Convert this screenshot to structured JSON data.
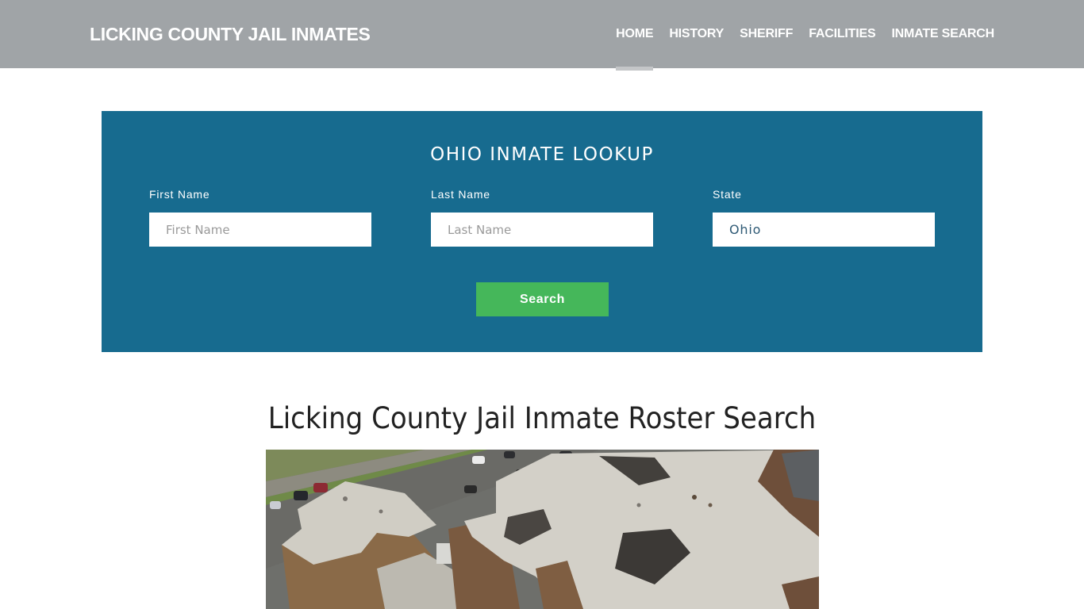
{
  "header": {
    "brand": "LICKING COUNTY JAIL INMATES",
    "nav": [
      {
        "label": "HOME",
        "active": true
      },
      {
        "label": "HISTORY",
        "active": false
      },
      {
        "label": "SHERIFF",
        "active": false
      },
      {
        "label": "FACILITIES",
        "active": false
      },
      {
        "label": "INMATE SEARCH",
        "active": false
      }
    ]
  },
  "lookup": {
    "title": "OHIO INMATE LOOKUP",
    "first_name": {
      "label": "First Name",
      "placeholder": "First Name",
      "value": ""
    },
    "last_name": {
      "label": "Last Name",
      "placeholder": "Last Name",
      "value": ""
    },
    "state": {
      "label": "State",
      "value": "Ohio"
    },
    "search_label": "Search"
  },
  "main": {
    "title": "Licking County Jail Inmate Roster Search",
    "image_alt": "Aerial view of Licking County Jail rooftops"
  },
  "colors": {
    "navbar": "#a0a4a7",
    "lookup_bg": "#176b8f",
    "search_button": "#45b75a"
  }
}
